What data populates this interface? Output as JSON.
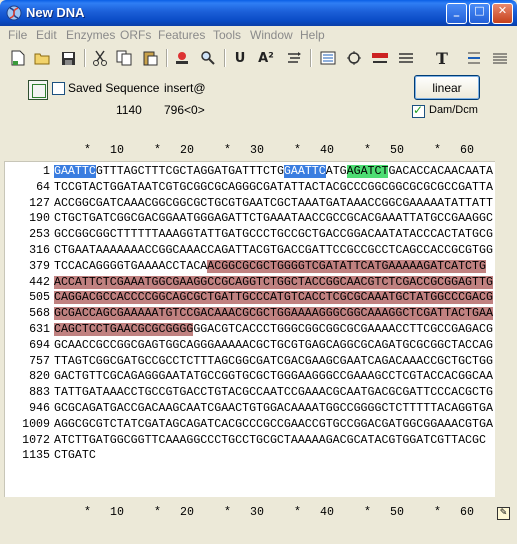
{
  "window": {
    "title": "New DNA",
    "buttons": {
      "minimize": "_",
      "maximize": "□",
      "close": "✕"
    }
  },
  "menu": [
    "File",
    "Edit",
    "Enzymes",
    "ORFs",
    "Features",
    "Tools",
    "Window",
    "Help"
  ],
  "toolbar": {
    "icons": [
      "new-file-icon",
      "open-folder-icon",
      "save-icon",
      "cut-icon",
      "copy-icon",
      "paste-icon",
      "restriction-enzyme-icon",
      "search-icon",
      "cut-site-icon",
      "translate-icon",
      "orf-icon",
      "map-view-icon",
      "circular-map-icon",
      "enzyme-list-icon",
      "text-icon",
      "align-icon",
      "sequence-view-icon"
    ],
    "glyphs": {
      "text": "T",
      "translate": "A²",
      "cut_site": "U"
    }
  },
  "options": {
    "saved_sequence_label": "Saved Sequence",
    "saved_sequence_checked": false,
    "mode": "insert@",
    "length": "1140",
    "cursor_info": "796<0>",
    "topology_button": "linear",
    "dam_dcm_label": "Dam/Dcm",
    "dam_dcm_checked": true
  },
  "ruler": {
    "marks": [
      "*",
      "10",
      "*",
      "20",
      "*",
      "30",
      "*",
      "40",
      "*",
      "50",
      "*",
      "60"
    ]
  },
  "colors": {
    "ecori_site": "#3a7de0",
    "bglii_site": "#4ddd73",
    "selection": "#c08180"
  },
  "sequence": {
    "rows": [
      {
        "num": "1",
        "segments": [
          {
            "text": "GAATTC",
            "style": "blue"
          },
          {
            "text": "GTTTAGCTTTCGCTAGGATGATTTCTG",
            "style": ""
          },
          {
            "text": "GAATTC",
            "style": "blue"
          },
          {
            "text": "ATG",
            "style": ""
          },
          {
            "text": "AGATCT",
            "style": "green"
          },
          {
            "text": "GACACCACAACAATA",
            "style": ""
          }
        ]
      },
      {
        "num": "64",
        "segments": [
          {
            "text": "TCCGTACTGGATAATCGTGCGGCGCAGGGCGATATTACTACGCCCGGCGGCGCGCGCCGATTA",
            "style": ""
          }
        ]
      },
      {
        "num": "127",
        "segments": [
          {
            "text": "ACCGGCGATCAAACGGCGGCGCTGCGTGAATCGCTAAATGATAAACCGGCGAAAAATATTATT",
            "style": ""
          }
        ]
      },
      {
        "num": "190",
        "segments": [
          {
            "text": "CTGCTGATCGGCGACGGAATGGGAGATTCTGAAATAACCGCCGCACGAAATTATGCCGAAGGC",
            "style": ""
          }
        ]
      },
      {
        "num": "253",
        "segments": [
          {
            "text": "GCCGGCGGCTTTTTTAAAGGTATTGATGCCCTGCCGCTGACCGGACAATATACCCACTATGCG",
            "style": ""
          }
        ]
      },
      {
        "num": "316",
        "segments": [
          {
            "text": "CTGAATAAAAAAACCGGCAAACCAGATTACGTGACCGATTCCGCCGCCTCAGCCACCGCGTGG",
            "style": ""
          }
        ]
      },
      {
        "num": "379",
        "segments": [
          {
            "text": "TCCACAGGGGTGAAAACCTACA",
            "style": ""
          },
          {
            "text": "ACGGCGCGCTGGGGTCGATATTCATGAAAAAGATCATCTG",
            "style": "red"
          }
        ]
      },
      {
        "num": "442",
        "segments": [
          {
            "text": "ACCATTCTCGAAATGGCGAAGGCCGCAGGTCTGGCTACCGGCAACGTCTCGACCGCGGAGTTG",
            "style": "red"
          }
        ]
      },
      {
        "num": "505",
        "segments": [
          {
            "text": "CAGGACGCCACCCCGGCAGCGCTGATTGCCCATGTCACCTCGCGCAAATGCTATGGCCCGACG",
            "style": "red"
          }
        ]
      },
      {
        "num": "568",
        "segments": [
          {
            "text": "GCGACCAGCGAAAAATGTCCGACAAACGCGCTGGAAAAGGGCGGCAAAGGCTCGATTACTGAA",
            "style": "red"
          }
        ]
      },
      {
        "num": "631",
        "segments": [
          {
            "text": "CAGCTCCTGAACGCGCGGGG",
            "style": "red"
          },
          {
            "text": "GGACGTCACCCTGGGCGGCGGCGCGAAAACCTTCGCCGAGACG",
            "style": ""
          }
        ]
      },
      {
        "num": "694",
        "segments": [
          {
            "text": "GCAACCGCCGGCGAGTGGCAGGGAAAAACGCTGCGTGAGCAGGCGCAGATGCGCGGCTACCAG",
            "style": ""
          }
        ]
      },
      {
        "num": "757",
        "segments": [
          {
            "text": "TTAGTCGGCGATGCCGCCTCTTTAGCGGCGATCGACGAAGCGAATCAGACAAACCGCTGCTGG",
            "style": ""
          }
        ]
      },
      {
        "num": "820",
        "segments": [
          {
            "text": "GACTGTTCGCAGAGGGAATATGCCGGTGCGCTGGGAAGGGCCGAAAGCCTCGTACCACGGCAA",
            "style": ""
          }
        ]
      },
      {
        "num": "883",
        "segments": [
          {
            "text": "TATTGATAAACCTGCCGTGACCTGTACGCCAATCCGAAACGCAATGACGCGATTCCCACGCTG",
            "style": ""
          }
        ]
      },
      {
        "num": "946",
        "segments": [
          {
            "text": "GCGCAGATGACCGACAAGCAATCGAACTGTGGACAAAATGGCCGGGGCTCTTTTTACAGGTGA",
            "style": ""
          }
        ]
      },
      {
        "num": "1009",
        "segments": [
          {
            "text": "AGGCGCGTCTATCGATAGCAGATCACGCCCGCCGAACCGTGCCGGACGATGGCGGAAACGTGA",
            "style": ""
          }
        ]
      },
      {
        "num": "1072",
        "segments": [
          {
            "text": "ATCTTGATGGCGGTTCAAAGGCCCTGCCTGCGCTAAAAAGACGCATACGTGGATCGTTACGC",
            "style": ""
          }
        ]
      },
      {
        "num": "1135",
        "segments": [
          {
            "text": "CTGATC",
            "style": ""
          }
        ]
      }
    ]
  }
}
